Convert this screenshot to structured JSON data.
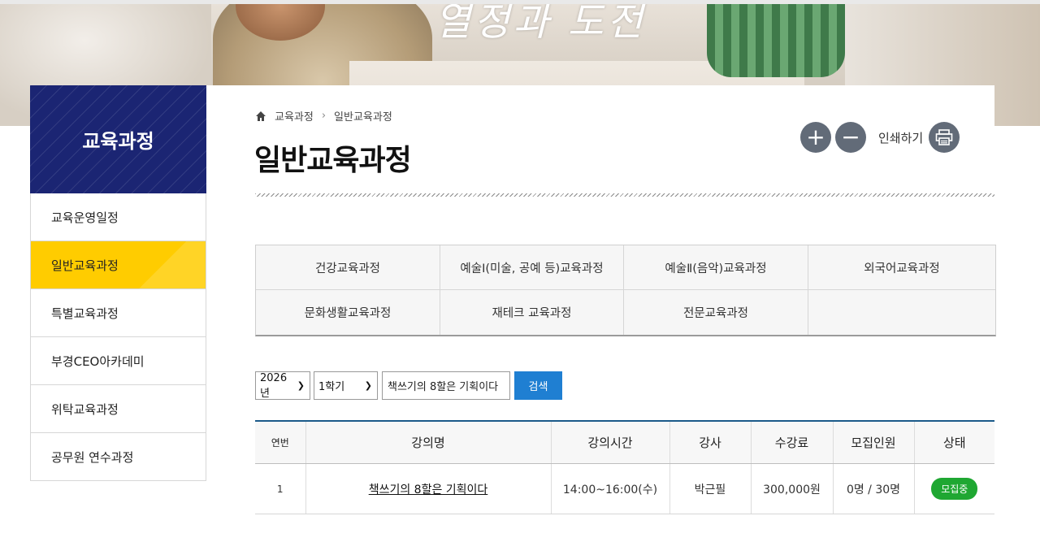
{
  "banner": {
    "script_text": "열정과 도전"
  },
  "sidebar": {
    "title": "교육과정",
    "items": [
      {
        "label": "교육운영일정",
        "active": false
      },
      {
        "label": "일반교육과정",
        "active": true
      },
      {
        "label": "특별교육과정",
        "active": false
      },
      {
        "label": "부경CEO아카데미",
        "active": false
      },
      {
        "label": "위탁교육과정",
        "active": false
      },
      {
        "label": "공무원 연수과정",
        "active": false
      }
    ]
  },
  "breadcrumb": {
    "items": [
      "교육과정",
      "일반교육과정"
    ]
  },
  "page_title": "일반교육과정",
  "tools": {
    "zoom_in": "+",
    "zoom_out": "−",
    "print_label": "인쇄하기"
  },
  "categories": [
    "건강교육과정",
    "예술Ⅰ(미술, 공예 등)교육과정",
    "예술Ⅱ(음악)교육과정",
    "외국어교육과정",
    "문화생활교육과정",
    "재테크 교육과정",
    "전문교육과정",
    ""
  ],
  "search": {
    "year": "2026년",
    "term": "1학기",
    "keyword": "책쓰기의 8할은 기획이다",
    "button": "검색"
  },
  "table": {
    "headers": [
      "연번",
      "강의명",
      "강의시간",
      "강사",
      "수강료",
      "모집인원",
      "상태"
    ],
    "rows": [
      {
        "no": "1",
        "name": "책쓰기의 8할은 기획이다",
        "time": "14:00~16:00(수)",
        "instructor": "박근필",
        "fee": "300,000원",
        "capacity": "0명 / 30명",
        "status": "모집중"
      }
    ]
  },
  "colors": {
    "sidebar_head": "#1b2573",
    "active_item": "#ffcc00",
    "search_button": "#1f7fd2",
    "status_badge": "#1fa732"
  }
}
